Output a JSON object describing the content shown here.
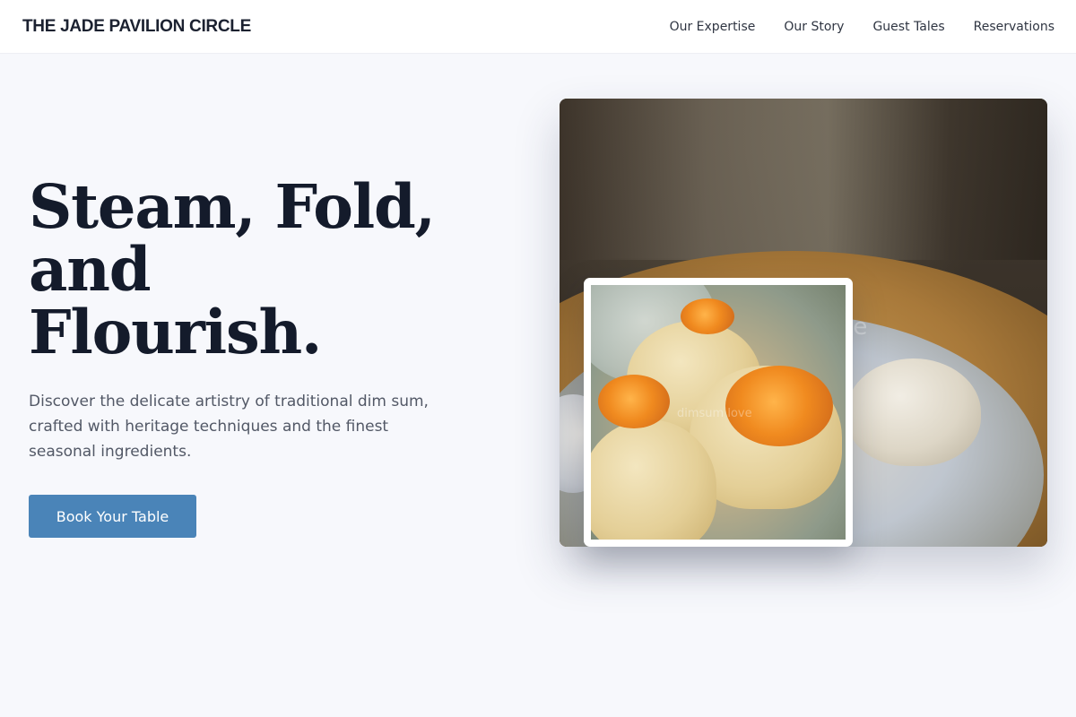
{
  "brand": {
    "name": "THE JADE PAVILION CIRCLE"
  },
  "nav": {
    "items": [
      {
        "label": "Our Expertise"
      },
      {
        "label": "Our Story"
      },
      {
        "label": "Guest Tales"
      },
      {
        "label": "Reservations"
      }
    ]
  },
  "hero": {
    "title_line1": "Steam, Fold,",
    "title_line2": "and Flourish.",
    "subtitle": "Discover the delicate artistry of traditional dim sum, crafted with heritage techniques and the finest seasonal ingredients.",
    "cta_label": "Book Your Table"
  },
  "images": {
    "main_watermark": "ve",
    "inset_watermark": "dimsum love"
  },
  "colors": {
    "page_background": "#f7f8fc",
    "nav_background": "#ffffff",
    "heading_text": "#141b2b",
    "body_text": "#525866",
    "cta_background": "#4a84b8",
    "cta_text": "#ffffff"
  }
}
